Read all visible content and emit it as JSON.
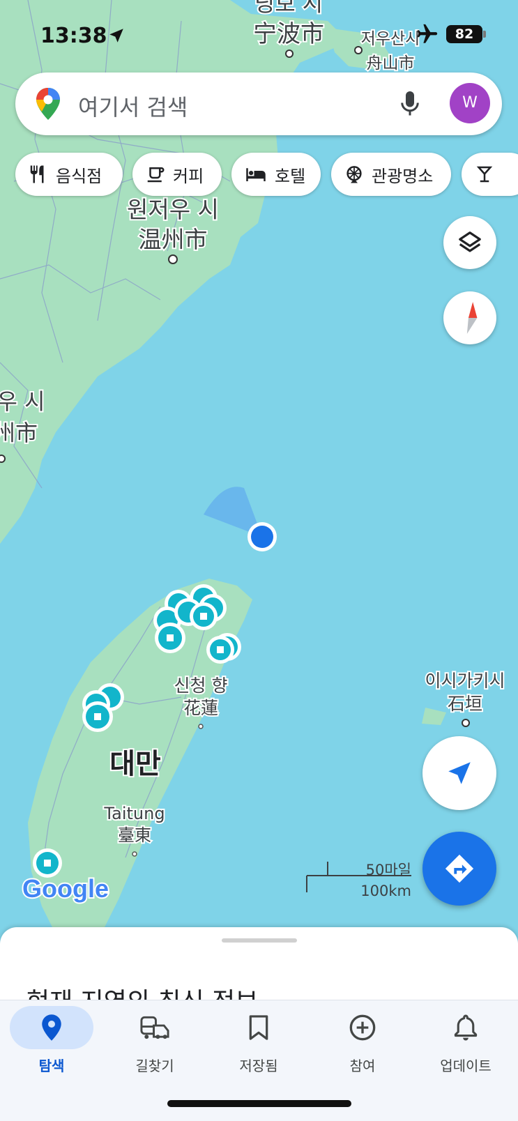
{
  "status_bar": {
    "time": "13:38",
    "battery": "82"
  },
  "search": {
    "placeholder": "여기서 검색",
    "avatar_letter": "W"
  },
  "categories": [
    {
      "label": "음식점",
      "icon": "restaurant-icon"
    },
    {
      "label": "커피",
      "icon": "coffee-icon"
    },
    {
      "label": "호텔",
      "icon": "hotel-icon"
    },
    {
      "label": "관광명소",
      "icon": "attraction-icon"
    },
    {
      "label": "",
      "icon": "bar-icon"
    }
  ],
  "map": {
    "labels": {
      "ningbo_ko": "닝보 시",
      "ningbo_zh": "宁波市",
      "zhoushan_ko": "저우산시",
      "zhoushan_zh": "舟山市",
      "wenzhou_ko": "원저우 시",
      "wenzhou_zh": "温州市",
      "fuzhou_ko": "우 시",
      "fuzhou_zh": "州市",
      "hualien_ko": "신청 향",
      "hualien_zh": "花蓮",
      "ishigaki_ko": "이시가키시",
      "ishigaki_zh": "石垣",
      "taiwan": "대만",
      "taitung_en": "Taitung",
      "taitung_zh": "臺東"
    },
    "logo": "Google",
    "scale": {
      "miles": "50마일",
      "km": "100km"
    },
    "colors": {
      "water": "#7fd3e8",
      "land": "#a8e0bf",
      "accent": "#1a73e8",
      "transit_pin": "#12b5cb"
    }
  },
  "sheet": {
    "title": "현재 지역의 최신 정보"
  },
  "bottom_nav": [
    {
      "label": "탐색",
      "icon": "explore-pin-icon",
      "active": true
    },
    {
      "label": "길찾기",
      "icon": "commute-icon",
      "active": false
    },
    {
      "label": "저장됨",
      "icon": "bookmark-icon",
      "active": false
    },
    {
      "label": "참여",
      "icon": "add-circle-icon",
      "active": false
    },
    {
      "label": "업데이트",
      "icon": "bell-icon",
      "active": false
    }
  ]
}
